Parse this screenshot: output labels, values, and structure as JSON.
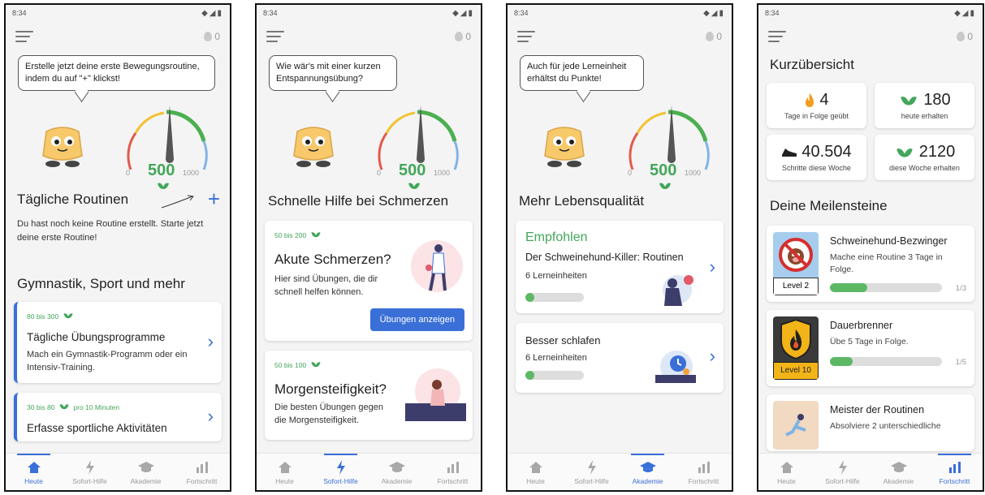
{
  "status": {
    "time": "8:34",
    "icons": "◆◢▮"
  },
  "streak_value": "0",
  "gauge": {
    "value": "500",
    "min": "0",
    "max": "1000",
    "level": 0.5
  },
  "nav": [
    {
      "label": "Heute"
    },
    {
      "label": "Sofort-Hilfe"
    },
    {
      "label": "Akademie"
    },
    {
      "label": "Fortschritt"
    }
  ],
  "screen1": {
    "bubble": "Erstelle jetzt deine erste Bewegungsroutine, indem du auf \"+\" klickst!",
    "routines_title": "Tägliche Routinen",
    "plus": "+",
    "empty_text": "Du hast noch keine Routine erstellt. Starte jetzt deine erste Routine!",
    "section2_title": "Gymnastik, Sport und mehr",
    "card1_points": "80 bis 300",
    "card1_title": "Tägliche Übungsprogramme",
    "card1_text": "Mach ein Gymnastik-Programm oder ein Intensiv-Training.",
    "card2_points": "30 bis 80",
    "card2_extra": "pro 10 Minuten",
    "card2_title": "Erfasse sportliche Aktivitäten"
  },
  "screen2": {
    "bubble": "Wie wär's mit einer kurzen Entspannungsübung?",
    "section_title": "Schnelle Hilfe bei Schmerzen",
    "card1_points": "50 bis 200",
    "card1_title": "Akute Schmerzen?",
    "card1_text": "Hier sind Übungen, die dir schnell helfen können.",
    "card1_button": "Übungen anzeigen",
    "card2_points": "50 bis 100",
    "card2_title": "Morgensteifigkeit?",
    "card2_text": "Die besten Übungen gegen die Morgensteifigkeit."
  },
  "screen3": {
    "bubble": "Auch für jede Lerneinheit erhältst du Punkte!",
    "section_title": "Mehr Lebensqualität",
    "card1_tag": "Empfohlen",
    "card1_title": "Der Schweinehund-Killer: Routinen",
    "card1_units": "6 Lerneinheiten",
    "card1_progress": 0.15,
    "card2_title": "Besser schlafen",
    "card2_units": "6 Lerneinheiten",
    "card2_progress": 0.15
  },
  "screen4": {
    "overview_title": "Kurzübersicht",
    "stat1_value": "4",
    "stat1_label": "Tage in Folge geübt",
    "stat2_value": "180",
    "stat2_label": "heute erhalten",
    "stat3_value": "40.504",
    "stat3_label": "Schritte diese Woche",
    "stat4_value": "2120",
    "stat4_label": "diese Woche erhalten",
    "milestones_title": "Deine Meilensteine",
    "m1_title": "Schweinehund-Bezwinger",
    "m1_text": "Mache eine Routine 3 Tage in Folge.",
    "m1_level": "Level 2",
    "m1_count": "1/3",
    "m1_progress": 0.33,
    "m2_title": "Dauerbrenner",
    "m2_text": "Übe 5 Tage in Folge.",
    "m2_level": "Level 10",
    "m2_count": "1/5",
    "m2_progress": 0.2,
    "m3_title": "Meister der Routinen",
    "m3_text": "Absolviere 2 unterschiedliche"
  },
  "colors": {
    "accent": "#3a6fd8",
    "green": "#43a65a",
    "progress": "#5cb864"
  }
}
